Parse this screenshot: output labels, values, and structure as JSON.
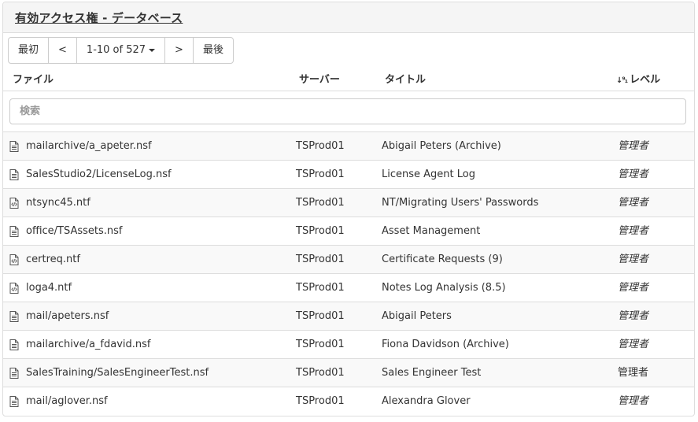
{
  "panel": {
    "title": "有効アクセス権 - データベース"
  },
  "pager": {
    "first": "最初",
    "prev": "<",
    "range": "1-10 of 527",
    "next": ">",
    "last": "最後"
  },
  "columns": {
    "file": "ファイル",
    "server": "サーバー",
    "title": "タイトル",
    "level": "レベル",
    "level_sort_icon": "↓⁹₁"
  },
  "search": {
    "placeholder": "検索",
    "value": ""
  },
  "rows": [
    {
      "icon": "database-file-icon",
      "file": "mailarchive/a_apeter.nsf",
      "server": "TSProd01",
      "title": "Abigail Peters (Archive)",
      "level": "管理者",
      "italic": true
    },
    {
      "icon": "database-file-icon",
      "file": "SalesStudio2/LicenseLog.nsf",
      "server": "TSProd01",
      "title": "License Agent Log",
      "level": "管理者",
      "italic": true
    },
    {
      "icon": "template-file-icon",
      "file": "ntsync45.ntf",
      "server": "TSProd01",
      "title": "NT/Migrating Users' Passwords",
      "level": "管理者",
      "italic": true
    },
    {
      "icon": "database-file-icon",
      "file": "office/TSAssets.nsf",
      "server": "TSProd01",
      "title": "Asset Management",
      "level": "管理者",
      "italic": true
    },
    {
      "icon": "template-file-icon",
      "file": "certreq.ntf",
      "server": "TSProd01",
      "title": "Certificate Requests (9)",
      "level": "管理者",
      "italic": true
    },
    {
      "icon": "template-file-icon",
      "file": "loga4.ntf",
      "server": "TSProd01",
      "title": "Notes Log Analysis (8.5)",
      "level": "管理者",
      "italic": true
    },
    {
      "icon": "database-file-icon",
      "file": "mail/apeters.nsf",
      "server": "TSProd01",
      "title": "Abigail Peters",
      "level": "管理者",
      "italic": true
    },
    {
      "icon": "database-file-icon",
      "file": "mailarchive/a_fdavid.nsf",
      "server": "TSProd01",
      "title": "Fiona Davidson (Archive)",
      "level": "管理者",
      "italic": true
    },
    {
      "icon": "database-file-icon",
      "file": "SalesTraining/SalesEngineerTest.nsf",
      "server": "TSProd01",
      "title": "Sales Engineer Test",
      "level": "管理者",
      "italic": false
    },
    {
      "icon": "database-file-icon",
      "file": "mail/aglover.nsf",
      "server": "TSProd01",
      "title": "Alexandra Glover",
      "level": "管理者",
      "italic": true
    }
  ]
}
